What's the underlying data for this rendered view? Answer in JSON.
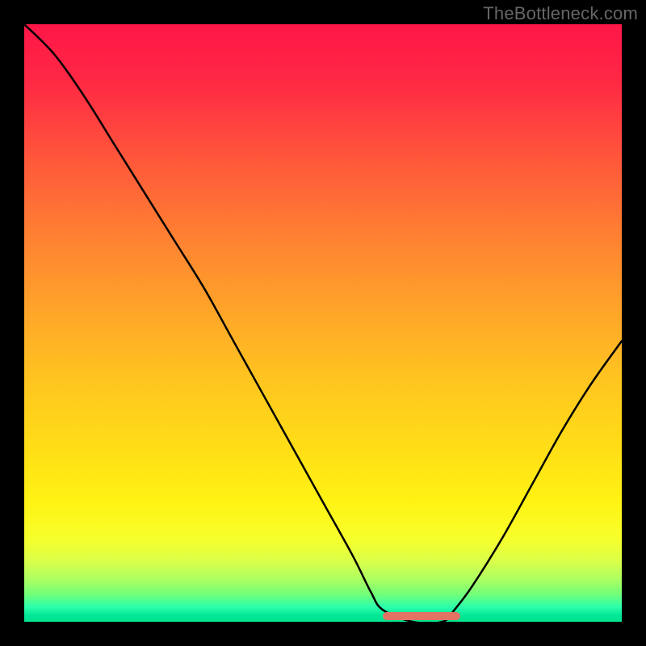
{
  "watermark": "TheBottleneck.com",
  "chart_data": {
    "type": "line",
    "title": "",
    "xlabel": "",
    "ylabel": "",
    "xlim": [
      0,
      100
    ],
    "ylim": [
      0,
      100
    ],
    "x": [
      0,
      5,
      10,
      15,
      20,
      25,
      30,
      35,
      40,
      45,
      50,
      55,
      58,
      60,
      65,
      70,
      72,
      75,
      80,
      85,
      90,
      95,
      100
    ],
    "values": [
      100,
      95,
      88,
      80,
      72,
      64,
      56,
      47,
      38,
      29,
      20,
      11,
      5,
      2,
      0,
      0,
      2,
      6,
      14,
      23,
      32,
      40,
      47
    ],
    "valley_marker": {
      "x_start": 60,
      "x_end": 73
    },
    "gradient_stops": [
      {
        "offset": 0.0,
        "color": "#ff1648"
      },
      {
        "offset": 0.1,
        "color": "#ff2a44"
      },
      {
        "offset": 0.22,
        "color": "#ff553b"
      },
      {
        "offset": 0.35,
        "color": "#ff7f32"
      },
      {
        "offset": 0.48,
        "color": "#ffa529"
      },
      {
        "offset": 0.6,
        "color": "#ffc61f"
      },
      {
        "offset": 0.72,
        "color": "#ffe016"
      },
      {
        "offset": 0.8,
        "color": "#fff314"
      },
      {
        "offset": 0.86,
        "color": "#f7ff2b"
      },
      {
        "offset": 0.9,
        "color": "#d9ff4a"
      },
      {
        "offset": 0.93,
        "color": "#aaff63"
      },
      {
        "offset": 0.955,
        "color": "#6fff7a"
      },
      {
        "offset": 0.975,
        "color": "#2dffad"
      },
      {
        "offset": 0.99,
        "color": "#00e796"
      },
      {
        "offset": 1.0,
        "color": "#00e28f"
      }
    ]
  }
}
